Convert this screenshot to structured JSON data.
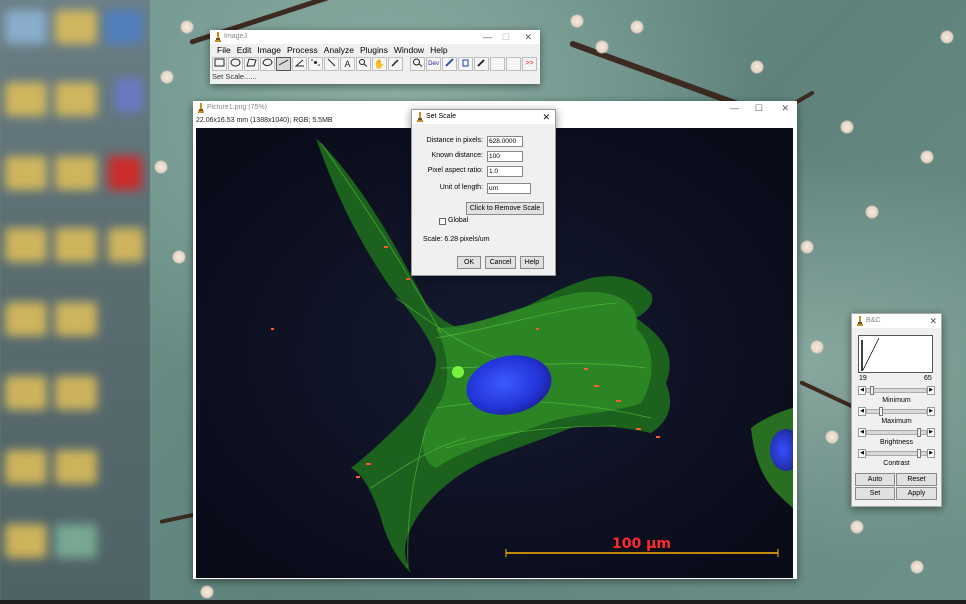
{
  "imagej": {
    "title": "ImageJ",
    "menu": [
      "File",
      "Edit",
      "Image",
      "Process",
      "Analyze",
      "Plugins",
      "Window",
      "Help"
    ],
    "dev_label": "Dev",
    "more_label": ">>",
    "status": "Set Scale......"
  },
  "image_window": {
    "title": "Picture1.png (75%)",
    "info": "22.06x16.53 mm (1388x1040); RGB; 5.5MB",
    "scale_bar_label": "100 µm",
    "scale_bar_color": "#ff2a2a"
  },
  "set_scale": {
    "title": "Set Scale",
    "fields": [
      {
        "label": "Distance in pixels:",
        "value": "628.0000"
      },
      {
        "label": "Known distance:",
        "value": "100"
      },
      {
        "label": "Pixel aspect ratio:",
        "value": "1.0"
      },
      {
        "label": "Unit of length:",
        "value": "um"
      }
    ],
    "remove_scale_button": "Click to Remove Scale",
    "global_label": "Global",
    "scale_text": "Scale: 6.28 pixels/um",
    "ok": "OK",
    "cancel": "Cancel",
    "help": "Help"
  },
  "bc": {
    "title": "B&C",
    "hist_min": "19",
    "hist_max": "65",
    "sliders": [
      {
        "label": "Minimum",
        "level": 0.07
      },
      {
        "label": "Maximum",
        "level": 0.23
      },
      {
        "label": "Brightness",
        "level": 0.9
      },
      {
        "label": "Contrast",
        "level": 0.9
      }
    ],
    "auto": "Auto",
    "reset": "Reset",
    "set": "Set",
    "apply": "Apply"
  },
  "window_controls": {
    "minimize": "—",
    "maximize": "☐",
    "close": "✕"
  }
}
